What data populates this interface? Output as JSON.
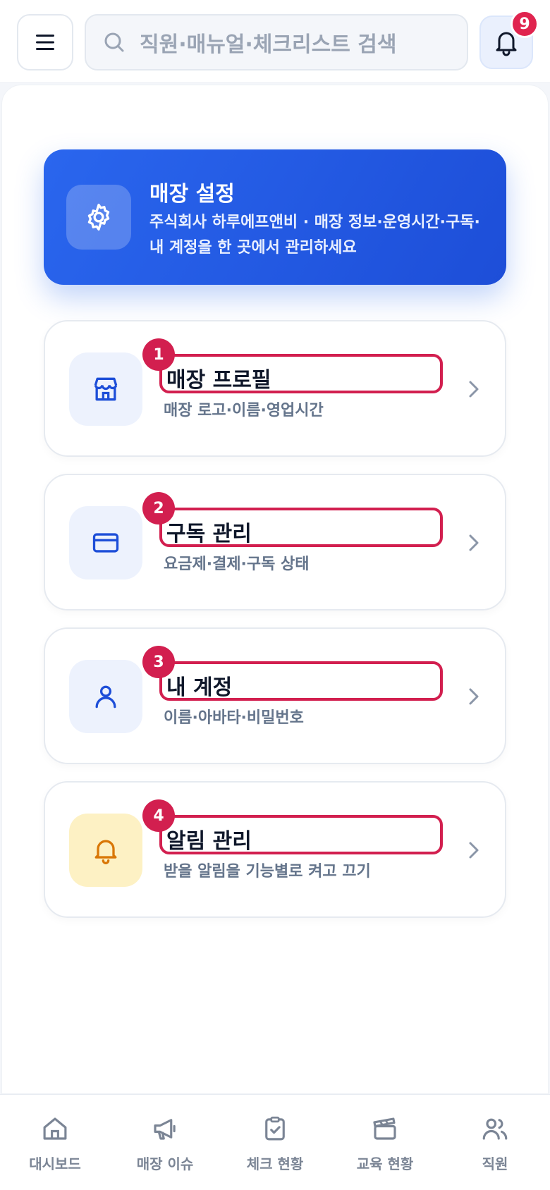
{
  "header": {
    "menu_icon": "hamburger-icon",
    "search_placeholder": "직원·매뉴얼·체크리스트 검색",
    "notification_count": "9"
  },
  "hero": {
    "icon": "gear-icon",
    "title": "매장 설정",
    "description": "주식회사 하루에프앤비 · 매장 정보·운영시간·구독·내 계정을 한 곳에서 관리하세요"
  },
  "settings": [
    {
      "number": "1",
      "title": "매장 프로필",
      "description": "매장 로고·이름·영업시간",
      "icon": "store-icon"
    },
    {
      "number": "2",
      "title": "구독 관리",
      "description": "요금제·결제·구독 상태",
      "icon": "credit-card-icon"
    },
    {
      "number": "3",
      "title": "내 계정",
      "description": "이름·아바타·비밀번호",
      "icon": "user-icon"
    },
    {
      "number": "4",
      "title": "알림 관리",
      "description": "받을 알림을 기능별로 켜고 끄기",
      "icon": "bell-icon"
    }
  ],
  "bottom_nav": [
    {
      "label": "대시보드",
      "icon": "home-icon"
    },
    {
      "label": "매장 이슈",
      "icon": "megaphone-icon"
    },
    {
      "label": "체크 현황",
      "icon": "clipboard-check-icon"
    },
    {
      "label": "교육 현황",
      "icon": "clapperboard-icon"
    },
    {
      "label": "직원",
      "icon": "users-icon"
    }
  ],
  "colors": {
    "primary": "#1d4ed8",
    "highlight": "#d21f4f",
    "muted": "#7b8595",
    "warning_bg": "#fdf1c4",
    "warning_icon": "#d97706"
  }
}
